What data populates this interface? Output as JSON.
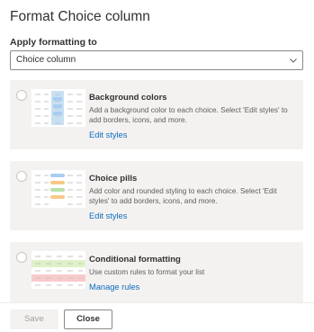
{
  "panel": {
    "title": "Format Choice column",
    "apply_label": "Apply formatting to",
    "apply_value": "Choice column"
  },
  "cards": [
    {
      "title": "Background colors",
      "description": "Add a background color to each choice. Select 'Edit styles' to add borders, icons, and more.",
      "link": "Edit styles"
    },
    {
      "title": "Choice pills",
      "description": "Add color and rounded styling to each choice. Select 'Edit styles' to add borders, icons, and more.",
      "link": "Edit styles"
    },
    {
      "title": "Conditional formatting",
      "description": "Use custom rules to format your list",
      "link": "Manage rules"
    }
  ],
  "footer": {
    "save_label": "Save",
    "close_label": "Close"
  },
  "colors": {
    "accent": "#0f6cbd",
    "card_bg": "#f3f2f1",
    "bg_blue": "#c7e0f4",
    "pill_blue": "#a9cdf0",
    "pill_orange": "#f8c98a",
    "pill_green": "#b7e0a8",
    "cond_green": "#dff1c7",
    "cond_red": "#f9c9cc"
  },
  "icons": {
    "dropdown": "chevron-down-icon",
    "radio": "radio-empty-icon"
  }
}
